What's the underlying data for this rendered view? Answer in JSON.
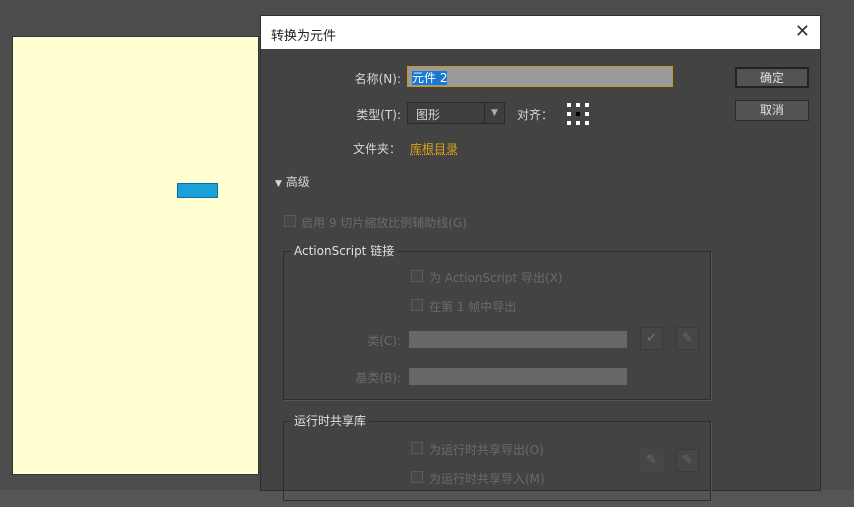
{
  "dialog": {
    "title": "转换为元件",
    "close_icon": "close-icon",
    "name_label": "名称(N):",
    "name_value": "元件 2",
    "type_label": "类型(T):",
    "type_value": "图形",
    "align_label": "对齐：",
    "folder_label": "文件夹：",
    "folder_value": "库根目录",
    "ok": "确定",
    "cancel": "取消",
    "advanced": "高级",
    "nine_slice": "启用 9 切片缩放比例辅助线(G)",
    "as_group": "ActionScript 链接",
    "as_export": "为 ActionScript 导出(X)",
    "export_frame1": "在第 1 帧中导出",
    "class_label": "类(C):",
    "base_class_label": "基类(B):",
    "rsl_group": "运行时共享库",
    "rsl_export": "为运行时共享导出(O)",
    "rsl_import": "为运行时共享导入(M)"
  },
  "colors": {
    "stage": "#ffffd2",
    "shape": "#1ba0d8",
    "folder": "#d9a21e",
    "focus": "#c8951e"
  }
}
